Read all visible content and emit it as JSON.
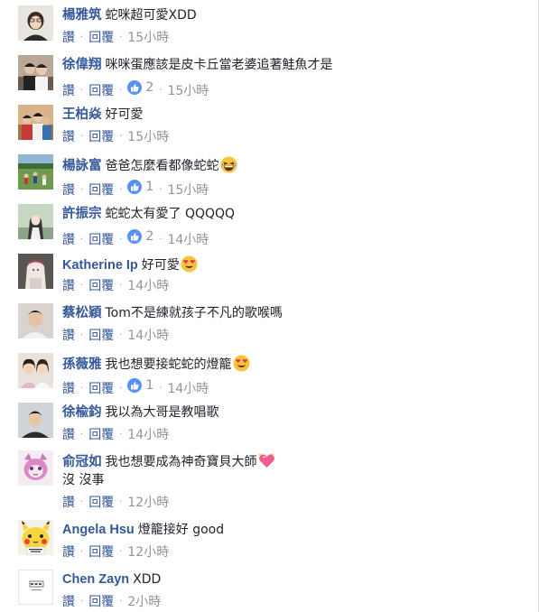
{
  "labels": {
    "like": "讚",
    "reply": "回覆",
    "separator": "·"
  },
  "colors": {
    "author_link": "#365899",
    "meta_gray": "#90949c",
    "like_blue": "#5890ff"
  },
  "comments": [
    {
      "author": "楊雅筑",
      "text": "蛇咪超可愛XDD",
      "likes": "",
      "time": "15小時",
      "avatar": "portrait-avatar-1"
    },
    {
      "author": "徐偉翔",
      "text": "咪咪蛋應該是皮卡丘當老婆追著鮭魚才是",
      "likes": "2",
      "time": "15小時",
      "avatar": "couple-photo-avatar"
    },
    {
      "author": "王柏焱",
      "text": "好可愛",
      "likes": "",
      "time": "15小時",
      "avatar": "group-photo-avatar"
    },
    {
      "author": "楊詠富",
      "text": "爸爸怎麼看都像蛇蛇",
      "emoji": "laughing-emoji",
      "likes": "1",
      "time": "15小時",
      "avatar": "outdoor-photo-avatar"
    },
    {
      "author": "許振宗",
      "text": "蛇蛇太有愛了 QQQQQ",
      "likes": "2",
      "time": "14小時",
      "avatar": "anime-girl-avatar"
    },
    {
      "author": "Katherine Ip",
      "text": "好可愛",
      "emoji": "heart-eyes-emoji",
      "likes": "",
      "time": "14小時",
      "avatar": "doll-avatar"
    },
    {
      "author": "蔡松穎",
      "text": "Tom不是練就孩子不凡的歌喉嗎",
      "likes": "",
      "time": "14小時",
      "avatar": "portrait-avatar-2"
    },
    {
      "author": "孫薇雅",
      "text": "我也想要接蛇蛇的燈籠",
      "emoji": "heart-eyes-emoji",
      "likes": "1",
      "time": "14小時",
      "avatar": "selfie-couple-avatar"
    },
    {
      "author": "徐楡鈞",
      "text": "我以為大哥是教唱歌",
      "likes": "",
      "time": "14小時",
      "avatar": "portrait-avatar-3"
    },
    {
      "author": "俞冠如",
      "text": "我也想要成為神奇寶貝大師",
      "emoji": "sparkling-heart-emoji",
      "text_line2": "沒 沒事",
      "likes": "",
      "time": "12小時",
      "avatar": "pink-cat-avatar"
    },
    {
      "author": "Angela Hsu",
      "text": "燈籠接好 good",
      "likes": "",
      "time": "12小時",
      "avatar": "pikachu-avatar"
    },
    {
      "author": "Chen Zayn",
      "text": "XDD",
      "likes": "",
      "time": "2小時",
      "avatar": "logo-avatar"
    }
  ]
}
